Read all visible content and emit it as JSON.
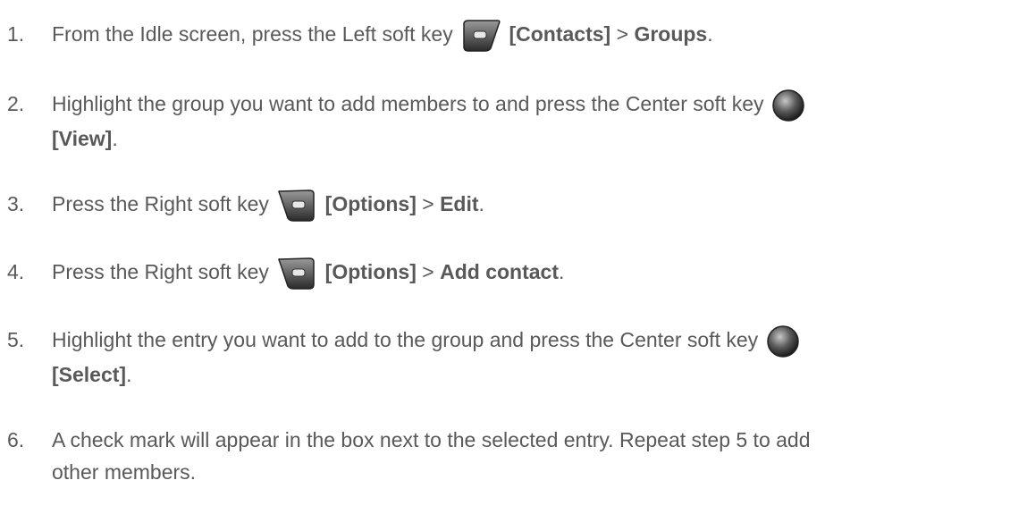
{
  "steps": [
    {
      "number": "1.",
      "pre": "From the Idle screen, press the Left soft key",
      "key_icon": "left-soft-key-icon",
      "bold1": "[Contacts]",
      "sep": " > ",
      "bold2": "Groups",
      "end": "."
    },
    {
      "number": "2.",
      "pre": "Highlight the group you want to add members to and press the Center soft key",
      "key_icon": "center-soft-key-icon",
      "bold1": "[View]",
      "end": "."
    },
    {
      "number": "3.",
      "pre": "Press the Right soft key",
      "key_icon": "right-soft-key-icon",
      "bold1": "[Options]",
      "sep": " > ",
      "bold2": "Edit",
      "end": "."
    },
    {
      "number": "4.",
      "pre": "Press the Right soft key",
      "key_icon": "right-soft-key-icon",
      "bold1": "[Options]",
      "sep": " > ",
      "bold2": "Add contact",
      "end": "."
    },
    {
      "number": "5.",
      "pre": "Highlight the entry you want to add to the group and press the Center soft key",
      "key_icon": "center-soft-key-icon",
      "bold1": "[Select]",
      "end": "."
    },
    {
      "number": "6.",
      "line1": "A check mark will appear in the box next to the selected entry. Repeat step 5 to add",
      "line2": "other members."
    }
  ]
}
